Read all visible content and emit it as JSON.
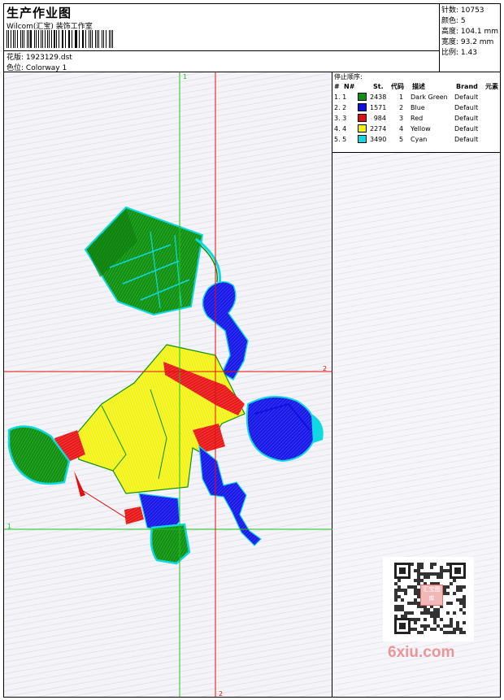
{
  "header": {
    "title": "生产作业图",
    "company": "Wilcom(汇宝) 装饰工作室",
    "pattern_label": "花版:",
    "pattern_value": "1923129.dst",
    "colorway_label": "色位:",
    "colorway_value": "Colorway 1"
  },
  "stats": {
    "stitches": "针数: 10753",
    "colors": "颜色: 5",
    "height": "高度: 104.1 mm",
    "width": "宽度: 93.2 mm",
    "scale": "比例: 1.43"
  },
  "stop_sequence": {
    "title": "停止顺序:",
    "headers": [
      "#",
      "N#",
      "St.",
      "代码",
      "描述",
      "Brand",
      "元素"
    ],
    "rows": [
      {
        "num": "1. 1",
        "color": "#109010",
        "stitches": "2438",
        "code": "1",
        "desc": "Dark Green",
        "brand": "Default"
      },
      {
        "num": "2. 2",
        "color": "#1010e0",
        "stitches": "1571",
        "code": "2",
        "desc": "Blue",
        "brand": "Default"
      },
      {
        "num": "3. 3",
        "color": "#e01010",
        "stitches": "984",
        "code": "3",
        "desc": "Red",
        "brand": "Default"
      },
      {
        "num": "4. 4",
        "color": "#f0f010",
        "stitches": "2274",
        "code": "4",
        "desc": "Yellow",
        "brand": "Default"
      },
      {
        "num": "5. 5",
        "color": "#10d8e0",
        "stitches": "3490",
        "code": "5",
        "desc": "Cyan",
        "brand": "Default"
      }
    ]
  },
  "guides": {
    "green_v_label": "1",
    "green_h_label": "1",
    "red_v_label": "2",
    "red_h_label": "2"
  },
  "watermark": {
    "text": "6xiu.com",
    "seal_text": "汇宝图库"
  },
  "colors": {
    "dark_green": "#109010",
    "blue": "#1010e0",
    "red": "#e01010",
    "yellow": "#f0f010",
    "cyan": "#10d8e0",
    "guide_green": "#20c020",
    "guide_red": "#e01010",
    "watermark": "#e8969a"
  }
}
